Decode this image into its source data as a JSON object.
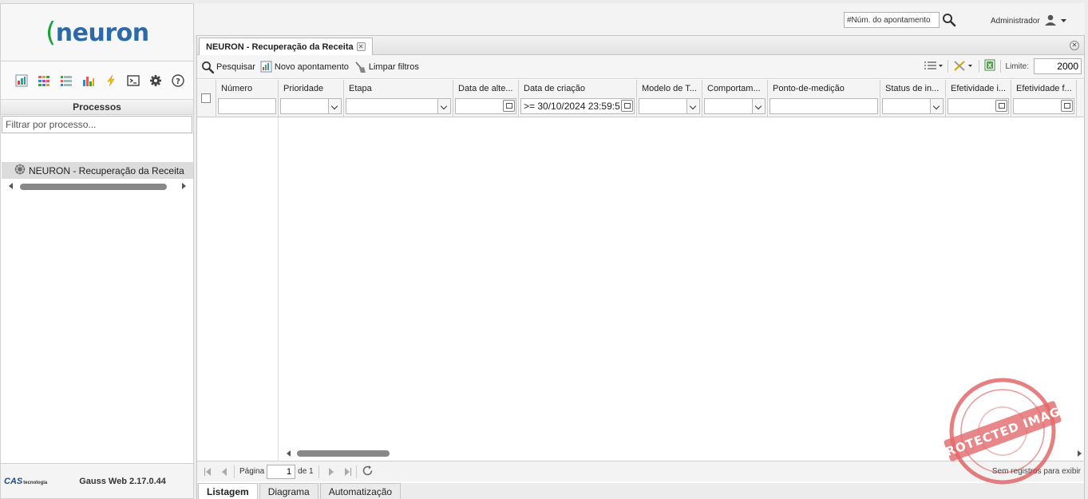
{
  "brand": {
    "logo_text": "neuron",
    "colors": {
      "blue": "#2d6aa6",
      "green": "#1aa33a"
    }
  },
  "sidebar": {
    "icons": [
      "dashboard-icon",
      "grid-icon",
      "list-icon",
      "bar-chart-icon",
      "lightning-icon",
      "terminal-icon",
      "gear-icon",
      "help-icon"
    ],
    "section_title": "Processos",
    "filter_placeholder": "Filtrar por processo...",
    "tree": [
      {
        "label": "NEURON - Recuperação da Receita",
        "icon": "process-wheel-icon"
      }
    ],
    "footer": {
      "company": "CAS",
      "company_sub": "tecnologia",
      "version": "Gauss Web 2.17.0.44"
    }
  },
  "topbar": {
    "search_placeholder": "#Núm. do apontamento",
    "user": "Administrador"
  },
  "panel": {
    "tab_title": "NEURON - Recuperação da Receita",
    "actions": {
      "search": "Pesquisar",
      "new": "Novo apontamento",
      "clear": "Limpar filtros"
    },
    "limit_label": "Limite:",
    "limit_value": "2000"
  },
  "grid": {
    "columns": [
      {
        "header": "Número",
        "filter": "text",
        "value": ""
      },
      {
        "header": "Prioridade",
        "filter": "select",
        "value": ""
      },
      {
        "header": "Etapa",
        "filter": "select",
        "value": ""
      },
      {
        "header": "Data de alte...",
        "filter": "date",
        "value": ""
      },
      {
        "header": "Data de criação",
        "filter": "date",
        "value": ">= 30/10/2024 23:59:5"
      },
      {
        "header": "Modelo de T...",
        "filter": "select",
        "value": ""
      },
      {
        "header": "Comportam...",
        "filter": "select",
        "value": ""
      },
      {
        "header": "Ponto-de-medição",
        "filter": "text",
        "value": ""
      },
      {
        "header": "Status de in...",
        "filter": "select",
        "value": ""
      },
      {
        "header": "Efetividade i...",
        "filter": "date",
        "value": ""
      },
      {
        "header": "Efetividade f...",
        "filter": "date",
        "value": ""
      }
    ]
  },
  "pager": {
    "page_label": "Página",
    "page_value": "1",
    "of_label": "de 1",
    "empty_text": "Sem registros para exibir"
  },
  "bottom_tabs": [
    {
      "label": "Listagem",
      "active": true
    },
    {
      "label": "Diagrama",
      "active": false
    },
    {
      "label": "Automatização",
      "active": false
    }
  ]
}
